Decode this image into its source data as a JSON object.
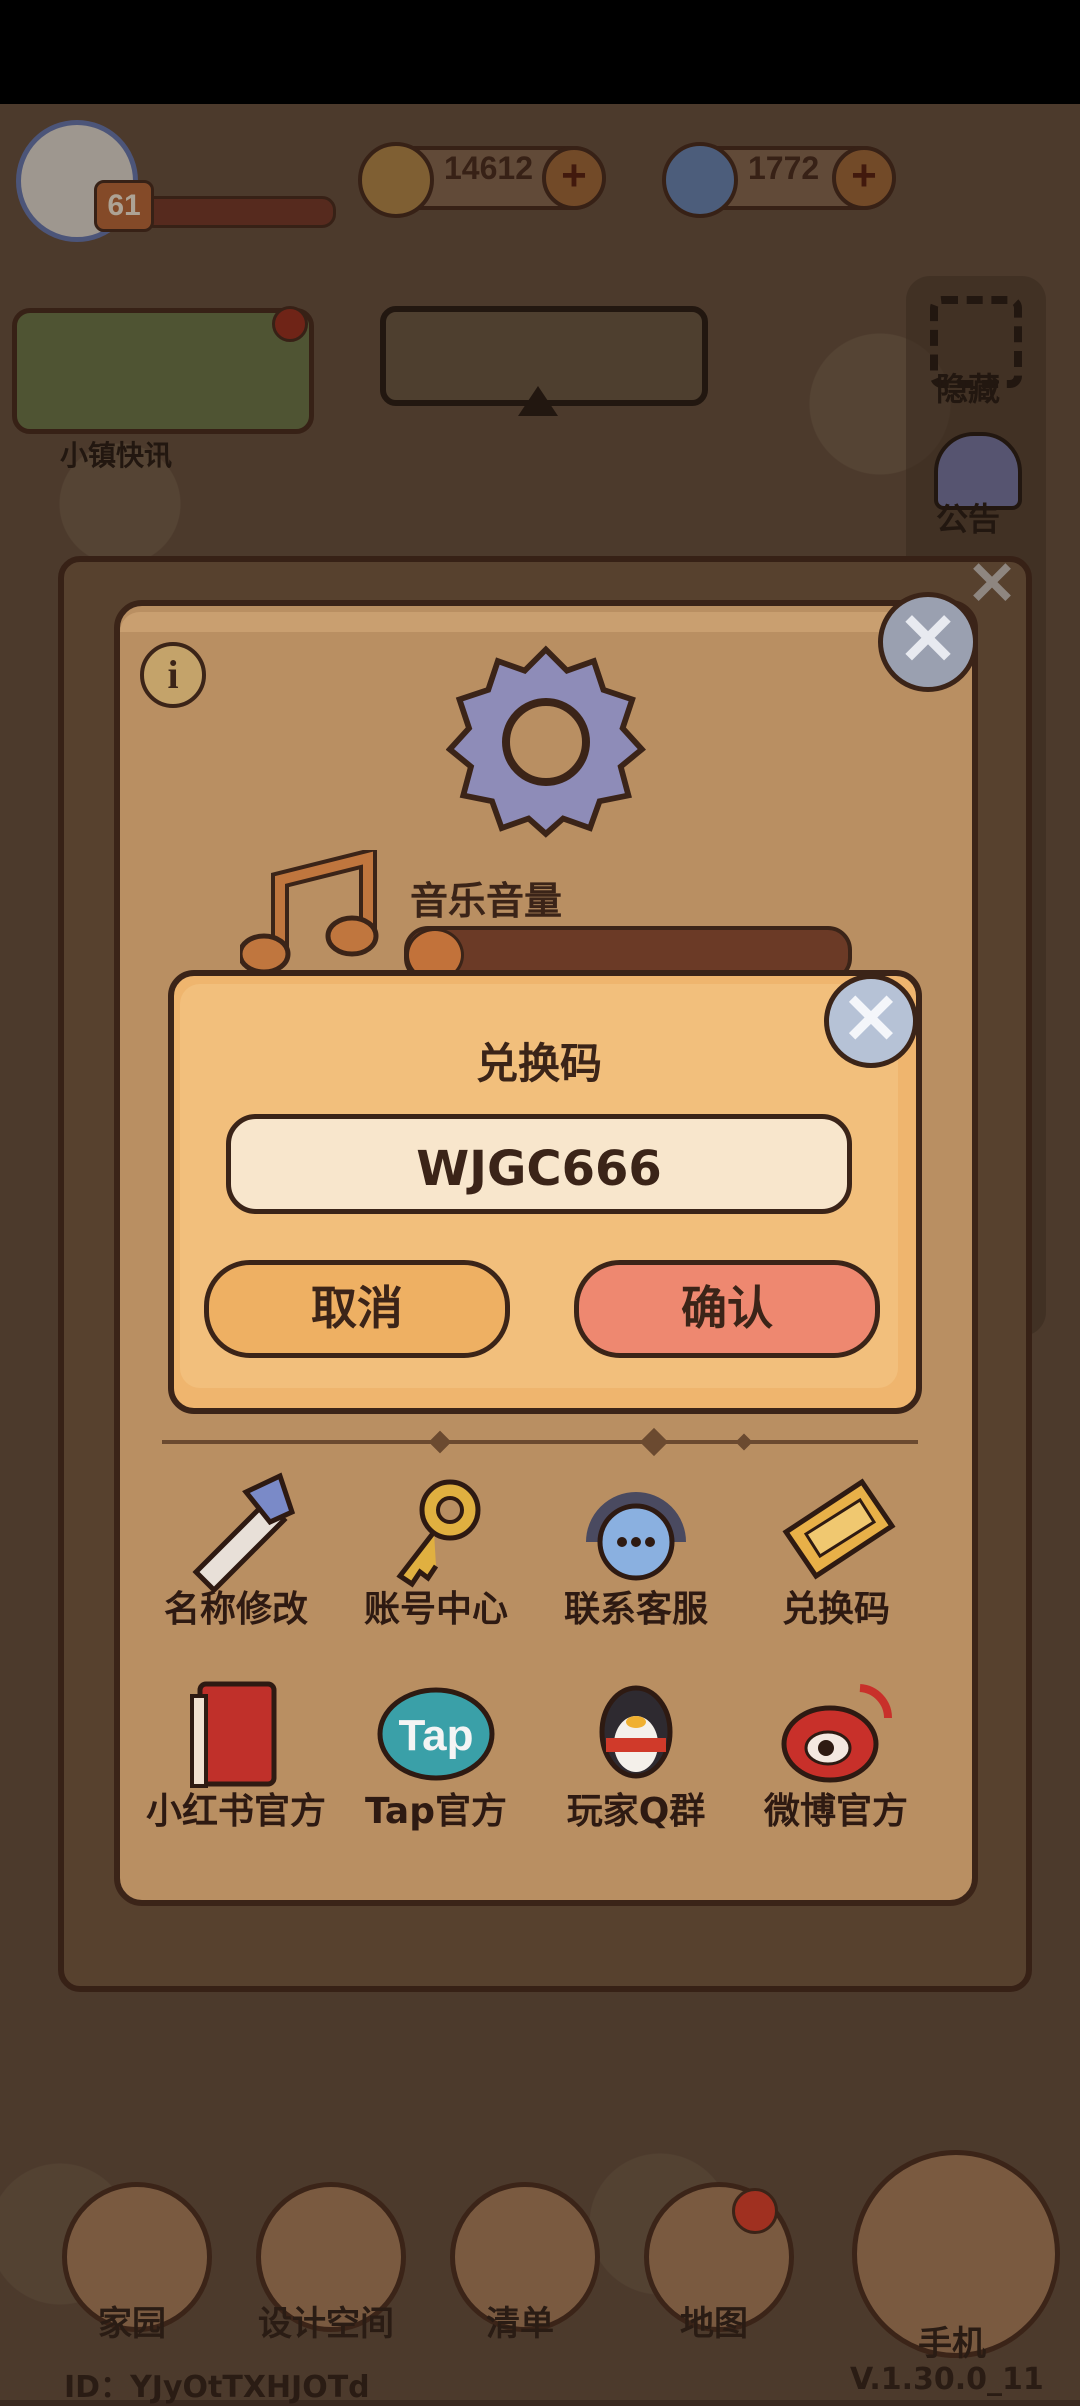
{
  "hud": {
    "level": "61",
    "currency_1": "14612",
    "currency_2": "1772",
    "plus": "+"
  },
  "news": {
    "label": "小镇快讯"
  },
  "side": {
    "hide_label": "隐藏",
    "notice_label": "公告"
  },
  "settings": {
    "music_label": "音乐音量",
    "music_volume_fraction": 0.05,
    "info": "i",
    "close": "✕",
    "grid": [
      {
        "label": "名称修改",
        "icon": "pencil-icon"
      },
      {
        "label": "账号中心",
        "icon": "key-icon"
      },
      {
        "label": "联系客服",
        "icon": "headset-icon"
      },
      {
        "label": "兑换码",
        "icon": "ticket-icon"
      },
      {
        "label": "小红书官方",
        "icon": "red-book-icon"
      },
      {
        "label": "Tap官方",
        "icon": "tap-icon"
      },
      {
        "label": "玩家Q群",
        "icon": "penguin-icon"
      },
      {
        "label": "微博官方",
        "icon": "weibo-icon"
      }
    ]
  },
  "redeem": {
    "title": "兑换码",
    "code": "WJGC666",
    "cancel": "取消",
    "confirm": "确认",
    "close": "✕"
  },
  "nav": {
    "items": [
      {
        "label": "家园"
      },
      {
        "label": "设计空间"
      },
      {
        "label": "清单"
      },
      {
        "label": "地图"
      }
    ],
    "phone": "手机"
  },
  "footer": {
    "id": "ID：YJyOtTXHJOTd",
    "version": "V.1.30.0_11"
  },
  "colors": {
    "dialog_bg": "#efb56e",
    "confirm": "#ee8870",
    "cancel": "#eeb063",
    "outline": "#3b2418"
  }
}
